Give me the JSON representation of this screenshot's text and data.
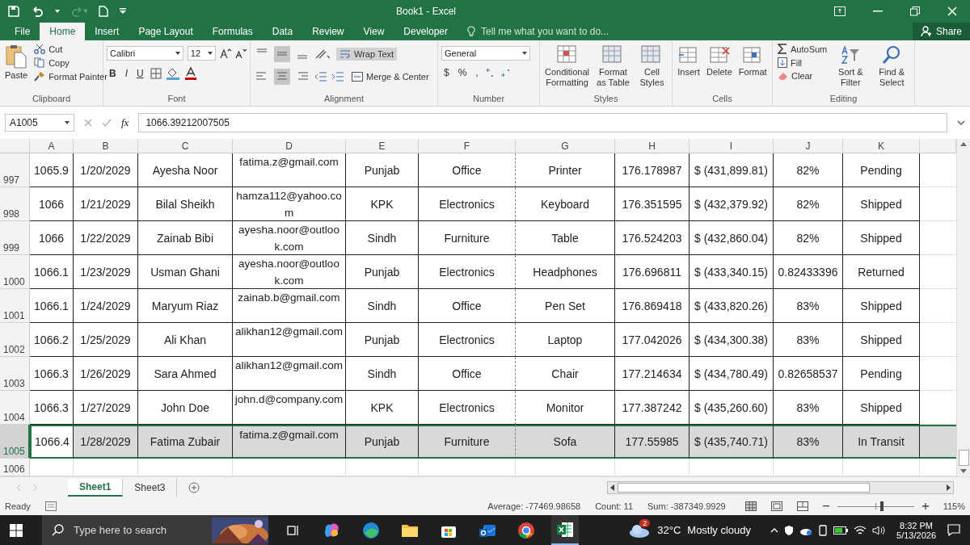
{
  "window": {
    "title": "Book1 - Excel"
  },
  "ribbon_tabs": [
    {
      "label": "File",
      "selected": false
    },
    {
      "label": "Home",
      "selected": true
    },
    {
      "label": "Insert",
      "selected": false
    },
    {
      "label": "Page Layout",
      "selected": false
    },
    {
      "label": "Formulas",
      "selected": false
    },
    {
      "label": "Data",
      "selected": false
    },
    {
      "label": "Review",
      "selected": false
    },
    {
      "label": "View",
      "selected": false
    },
    {
      "label": "Developer",
      "selected": false
    }
  ],
  "tell_me": {
    "placeholder": "Tell me what you want to do..."
  },
  "share": "Share",
  "clipboard": {
    "label": "Clipboard",
    "paste": "Paste",
    "cut": "Cut",
    "copy": "Copy",
    "format_painter": "Format Painter"
  },
  "font": {
    "label": "Font",
    "name": "Calibri",
    "size": "12",
    "bold": "B",
    "italic": "I",
    "underline": "U"
  },
  "alignment": {
    "label": "Alignment",
    "wrap_text": "Wrap Text",
    "wrap_on": true,
    "merge": "Merge & Center",
    "vertical": [
      {
        "selected": false
      },
      {
        "selected": true
      },
      {
        "selected": false
      }
    ],
    "horizontal": [
      {
        "selected": false
      },
      {
        "selected": true
      },
      {
        "selected": false
      }
    ]
  },
  "number": {
    "label": "Number",
    "format": "General",
    "currency": "$",
    "percent": "%",
    "comma": ","
  },
  "styles": {
    "label": "Styles",
    "items": [
      "Conditional Formatting",
      "Format as Table",
      "Cell Styles"
    ]
  },
  "cells": {
    "label": "Cells",
    "items": [
      "Insert",
      "Delete",
      "Format"
    ]
  },
  "editing": {
    "label": "Editing",
    "autosum": "AutoSum",
    "fill": "Fill",
    "clear": "Clear",
    "sort": "Sort & Filter",
    "find": "Find & Select"
  },
  "formula_bar": {
    "name_box": "A1005",
    "fx": "fx",
    "value": "1066.39212007505"
  },
  "columns": [
    "A",
    "B",
    "C",
    "D",
    "E",
    "F",
    "G",
    "H",
    "I",
    "J",
    "K"
  ],
  "rows": [
    {
      "row": "997",
      "selected": false,
      "cells": [
        "1065.9",
        "1/20/2029",
        "Ayesha Noor",
        "fatima.z@gmail.com",
        "Punjab",
        "Office",
        "Printer",
        "176.178987",
        "$ (431,899.81)",
        "82%",
        "Pending"
      ]
    },
    {
      "row": "998",
      "selected": false,
      "cells": [
        "1066",
        "1/21/2029",
        "Bilal Sheikh",
        "hamza112@yahoo.com",
        "KPK",
        "Electronics",
        "Keyboard",
        "176.351595",
        "$ (432,379.92)",
        "82%",
        "Shipped"
      ]
    },
    {
      "row": "999",
      "selected": false,
      "cells": [
        "1066",
        "1/22/2029",
        "Zainab Bibi",
        "ayesha.noor@outlook.com",
        "Sindh",
        "Furniture",
        "Table",
        "176.524203",
        "$ (432,860.04)",
        "82%",
        "Shipped"
      ]
    },
    {
      "row": "1000",
      "selected": false,
      "cells": [
        "1066.1",
        "1/23/2029",
        "Usman Ghani",
        "ayesha.noor@outlook.com",
        "Punjab",
        "Electronics",
        "Headphones",
        "176.696811",
        "$ (433,340.15)",
        "0.82433396",
        "Returned"
      ]
    },
    {
      "row": "1001",
      "selected": false,
      "cells": [
        "1066.1",
        "1/24/2029",
        "Maryum Riaz",
        "zainab.b@gmail.com",
        "Sindh",
        "Office",
        "Pen Set",
        "176.869418",
        "$ (433,820.26)",
        "83%",
        "Shipped"
      ]
    },
    {
      "row": "1002",
      "selected": false,
      "cells": [
        "1066.2",
        "1/25/2029",
        "Ali Khan",
        "alikhan12@gmail.com",
        "Punjab",
        "Electronics",
        "Laptop",
        "177.042026",
        "$ (434,300.38)",
        "83%",
        "Shipped"
      ]
    },
    {
      "row": "1003",
      "selected": false,
      "cells": [
        "1066.3",
        "1/26/2029",
        "Sara Ahmed",
        "alikhan12@gmail.com",
        "Sindh",
        "Office",
        "Chair",
        "177.214634",
        "$ (434,780.49)",
        "0.82658537",
        "Pending"
      ]
    },
    {
      "row": "1004",
      "selected": false,
      "cells": [
        "1066.3",
        "1/27/2029",
        "John Doe",
        "john.d@company.com",
        "KPK",
        "Electronics",
        "Monitor",
        "177.387242",
        "$ (435,260.60)",
        "83%",
        "Shipped"
      ]
    },
    {
      "row": "1005",
      "selected": true,
      "cells": [
        "1066.4",
        "1/28/2029",
        "Fatima Zubair",
        "fatima.z@gmail.com",
        "Punjab",
        "Furniture",
        "Sofa",
        "177.55985",
        "$ (435,740.71)",
        "83%",
        "In Transit"
      ]
    }
  ],
  "next_row": "1006",
  "sheets": [
    {
      "label": "Sheet1",
      "selected": true
    },
    {
      "label": "Sheet3",
      "selected": false
    }
  ],
  "status_bar": {
    "mode": "Ready",
    "average": "Average: -77469.98658",
    "count": "Count: 11",
    "sum": "Sum: -387349.9929",
    "zoom": "115%",
    "level": 0.58
  },
  "taskbar": {
    "search": {
      "placeholder": "Type here to search"
    },
    "apps": [
      {
        "kind": "taskview",
        "active": false
      },
      {
        "kind": "swirl",
        "active": false
      },
      {
        "kind": "wave",
        "active": false
      },
      {
        "kind": "folder",
        "active": false
      },
      {
        "kind": "bag",
        "active": false
      },
      {
        "kind": "mail",
        "active": false
      },
      {
        "kind": "circle",
        "active": false
      },
      {
        "kind": "sheet",
        "active": true
      }
    ],
    "weather_badge": "2",
    "temperature": "32°C",
    "weather": "Mostly cloudy",
    "time": "8:32 PM",
    "date": "5/13/2026"
  }
}
